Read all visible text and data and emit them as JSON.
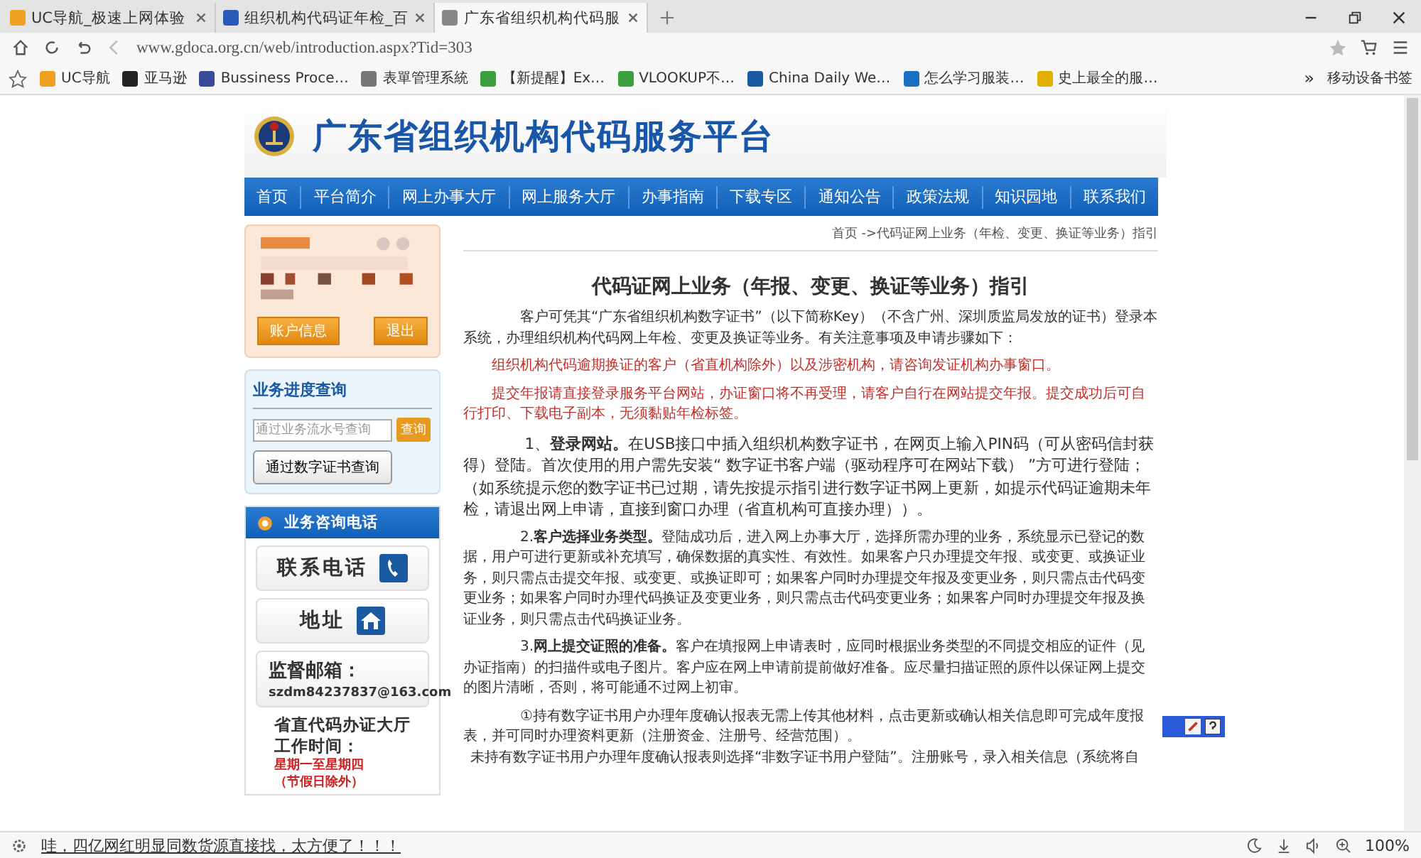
{
  "tabs": [
    {
      "title": "UC导航_极速上网体验",
      "selected": false,
      "color": "#f0a020"
    },
    {
      "title": "组织机构代码证年检_百",
      "selected": false,
      "color": "#2a5ab8"
    },
    {
      "title": "广东省组织机构代码服",
      "selected": true,
      "color": "#888888"
    }
  ],
  "address_bar": {
    "url": "www.gdoca.org.cn/web/introduction.aspx?Tid=303"
  },
  "bookmarks": [
    {
      "label": "UC导航",
      "color": "#f0a020"
    },
    {
      "label": "亚马逊",
      "color": "#222222"
    },
    {
      "label": "Bussiness Proce…",
      "color": "#3a4a9a"
    },
    {
      "label": "表單管理系統",
      "color": "#777777"
    },
    {
      "label": "【新提醒】Ex…",
      "color": "#3aa040"
    },
    {
      "label": "VLOOKUP不…",
      "color": "#3aa040"
    },
    {
      "label": "China Daily We…",
      "color": "#1a5aa0"
    },
    {
      "label": "怎么学习服装…",
      "color": "#1a70c0"
    },
    {
      "label": "史上最全的服…",
      "color": "#e0b000"
    }
  ],
  "bookmarks_more": "»",
  "mobile_bookmarks": "移动设备书签",
  "site": {
    "title": "广东省组织机构代码服务平台",
    "nav": [
      "首页",
      "平台简介",
      "网上办事大厅",
      "网上服务大厅",
      "办事指南",
      "下载专区",
      "通知公告",
      "政策法规",
      "知识园地",
      "联系我们"
    ]
  },
  "sidebar": {
    "login": {
      "buttons": [
        "账户信息",
        "退出"
      ]
    },
    "progress": {
      "title": "业务进度查询",
      "placeholder": "通过业务流水号查询",
      "search_button": "查询",
      "cert_button": "通过数字证书查询"
    },
    "consult": {
      "title": "业务咨询电话",
      "phone": "联系电话",
      "address": "地址",
      "email_label": "监督邮箱：",
      "email": "szdm84237837@163.com",
      "hall": "省直代码办证大厅",
      "hours_label": "工作时间：",
      "days": "星期一至星期四",
      "note": "（节假日除外）"
    }
  },
  "breadcrumb": "首页 ->代码证网上业务（年检、变更、换证等业务）指引",
  "article": {
    "title": "代码证网上业务（年报、变更、换证等业务）指引",
    "paragraphs": [
      {
        "kind": "normal",
        "text": "客户可凭其“广东省组织机构数字证书”（以下简称Key）（不含广州、深圳质监局发放的证书）登录本系统，办理组织机构代码网上年检、变更及换证等业务。有关注意事项及申请步骤如下："
      },
      {
        "kind": "warning",
        "text": "组织机构代码逾期换证的客户（省直机构除外）以及涉密机构，请咨询发证机构办事窗口。"
      },
      {
        "kind": "warning",
        "text": "提交年报请直接登录服务平台网站，办证窗口将不再受理，请客户自行在网站提交年报。提交成功后可自行打印、下载电子副本，无须黏贴年检标签。"
      },
      {
        "kind": "large",
        "text": "1、**登录网站。**在USB接口中插入组织机构数字证书，在网页上输入PIN码（可从密码信封获得）登陆。首次使用的用户需先安装“ 数字证书客户端（驱动程序可在网站下载） ”方可进行登陆；（如系统提示您的数字证书已过期，请先按提示指引进行数字证书网上更新，如提示代码证逾期未年检，请退出网上申请，直接到窗口办理（省直机构可直接办理））。"
      },
      {
        "kind": "normal",
        "text": "2.**客户选择业务类型。**登陆成功后，进入网上办事大厅，选择所需办理的业务，系统显示已登记的数据，用户可进行更新或补充填写，确保数据的真实性、有效性。如果客户只办理提交年报、或变更、或换证业务，则只需点击提交年报、或变更、或换证即可；如果客户同时办理提交年报及变更业务，则只需点击代码变更业务；如果客户同时办理代码换证及变更业务，则只需点击代码变更业务；如果客户同时办理提交年报及换证业务，则只需点击代码换证业务。"
      },
      {
        "kind": "normal",
        "text": "3.**网上提交证照的准备。**客户在填报网上申请表时，应同时根据业务类型的不同提交相应的证件（见办证指南）的扫描件或电子图片。客户应在网上申请前提前做好准备。应尽量扫描证照的原件以保证网上提交的图片清晰，否则，将可能通不过网上初审。"
      },
      {
        "kind": "normal",
        "text": "①持有数字证书用户办理年度确认报表无需上传其他材料，点击更新或确认相关信息即可完成年度报表，并可同时办理资料更新（注册资金、注册号、经营范围）。"
      },
      {
        "kind": "flush",
        "text": "未持有数字证书用户办理年度确认报表则选择“非数字证书用户登陆”。注册账号，录入相关信息（系统将自"
      }
    ]
  },
  "status_bar": {
    "news": "哇，四亿网红明显同数货源直接找，太方便了！！！",
    "zoom": "100%"
  }
}
